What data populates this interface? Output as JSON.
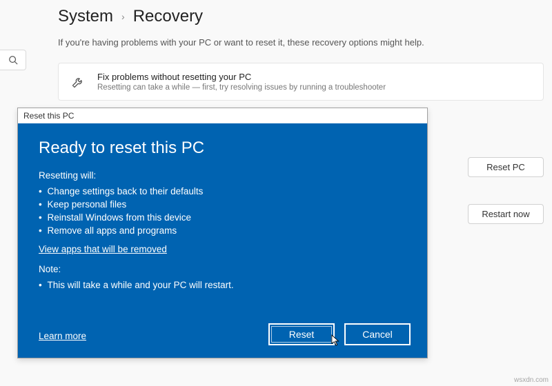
{
  "breadcrumb": {
    "parent": "System",
    "current": "Recovery"
  },
  "subtitle": "If you're having problems with your PC or want to reset it, these recovery options might help.",
  "card_fix": {
    "title": "Fix problems without resetting your PC",
    "desc": "Resetting can take a while — first, try resolving issues by running a troubleshooter"
  },
  "buttons": {
    "reset_pc": "Reset PC",
    "restart_now": "Restart now"
  },
  "dialog": {
    "titlebar": "Reset this PC",
    "heading": "Ready to reset this PC",
    "resetting_label": "Resetting will:",
    "bullets": [
      "Change settings back to their defaults",
      "Keep personal files",
      "Reinstall Windows from this device",
      "Remove all apps and programs"
    ],
    "view_apps": "View apps that will be removed",
    "note_label": "Note:",
    "note_bullets": [
      "This will take a while and your PC will restart."
    ],
    "learn_more": "Learn more",
    "reset": "Reset",
    "cancel": "Cancel"
  },
  "watermark": "wsxdn.com"
}
